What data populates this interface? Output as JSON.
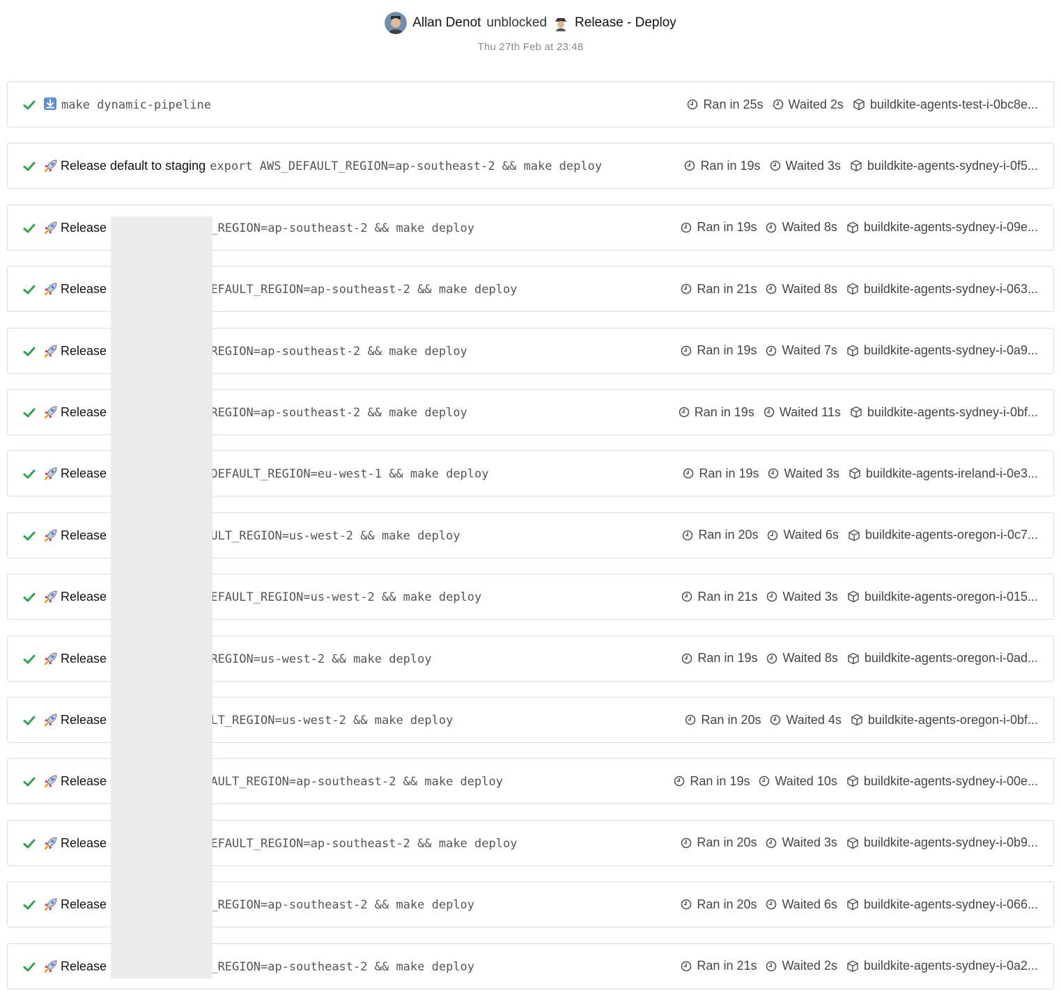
{
  "header": {
    "actor": "Allan Denot",
    "verb": "unblocked",
    "pipeline": "Release - Deploy",
    "timestamp": "Thu 27th Feb at 23:48"
  },
  "colors": {
    "success": "#2ea44f",
    "border": "#dcdcdc",
    "muted": "#8a8a8a",
    "redaction": "#ececec"
  },
  "jobs": [
    {
      "icon": "download-emoji",
      "label": "",
      "command": "make dynamic-pipeline",
      "ran": "Ran in 25s",
      "waited": "Waited 2s",
      "agent": "buildkite-agents-test-i-0bc8e..."
    },
    {
      "icon": "rocket-emoji",
      "label": "Release default to staging",
      "command": "export AWS_DEFAULT_REGION=ap-southeast-2 && make deploy",
      "ran": "Ran in 19s",
      "waited": "Waited 3s",
      "agent": "buildkite-agents-sydney-i-0f5..."
    },
    {
      "icon": "rocket-emoji",
      "label": "Release",
      "command": "rt AWS_DEFAULT_REGION=ap-southeast-2 && make deploy",
      "ran": "Ran in 19s",
      "waited": "Waited 8s",
      "agent": "buildkite-agents-sydney-i-09e..."
    },
    {
      "icon": "rocket-emoji",
      "label": "Release",
      "command": "d export AWS_DEFAULT_REGION=ap-southeast-2 && make deploy",
      "ran": "Ran in 21s",
      "waited": "Waited 8s",
      "agent": "buildkite-agents-sydney-i-063..."
    },
    {
      "icon": "rocket-emoji",
      "label": "Release",
      "command": "t AWS_DEFAULT_REGION=ap-southeast-2 && make deploy",
      "ran": "Ran in 19s",
      "waited": "Waited 7s",
      "agent": "buildkite-agents-sydney-i-0a9..."
    },
    {
      "icon": "rocket-emoji",
      "label": "Release",
      "command": "t AWS_DEFAULT_REGION=ap-southeast-2 && make deploy",
      "ran": "Ran in 19s",
      "waited": "Waited 11s",
      "agent": "buildkite-agents-sydney-i-0bf..."
    },
    {
      "icon": "rocket-emoji",
      "label": "Release",
      "command": "ox export AWS_DEFAULT_REGION=eu-west-1 && make deploy",
      "ran": "Ran in 19s",
      "waited": "Waited 3s",
      "agent": "buildkite-agents-ireland-i-0e3..."
    },
    {
      "icon": "rocket-emoji",
      "label": "Release",
      "command": "xport AWS_DEFAULT_REGION=us-west-2 && make deploy",
      "ran": "Ran in 20s",
      "waited": "Waited 6s",
      "agent": "buildkite-agents-oregon-i-0c7..."
    },
    {
      "icon": "rocket-emoji",
      "label": "Release",
      "command": "l export AWS_DEFAULT_REGION=us-west-2 && make deploy",
      "ran": "Ran in 21s",
      "waited": "Waited 3s",
      "agent": "buildkite-agents-oregon-i-015..."
    },
    {
      "icon": "rocket-emoji",
      "label": "Release",
      "command": "t AWS_DEFAULT_REGION=us-west-2 && make deploy",
      "ran": "Ran in 19s",
      "waited": "Waited 8s",
      "agent": "buildkite-agents-oregon-i-0ad..."
    },
    {
      "icon": "rocket-emoji",
      "label": "Release",
      "command": "port AWS_DEFAULT_REGION=us-west-2 && make deploy",
      "ran": "Ran in 20s",
      "waited": "Waited 4s",
      "agent": "buildkite-agents-oregon-i-0bf..."
    },
    {
      "icon": "rocket-emoji",
      "label": "Release",
      "command": "export AWS_DEFAULT_REGION=ap-southeast-2 && make deploy",
      "ran": "Ran in 19s",
      "waited": "Waited 10s",
      "agent": "buildkite-agents-sydney-i-00e..."
    },
    {
      "icon": "rocket-emoji",
      "label": "Release",
      "command": "d export AWS_DEFAULT_REGION=ap-southeast-2 && make deploy",
      "ran": "Ran in 20s",
      "waited": "Waited 3s",
      "agent": "buildkite-agents-sydney-i-0b9..."
    },
    {
      "icon": "rocket-emoji",
      "label": "Release",
      "command": "rt AWS_DEFAULT_REGION=ap-southeast-2 && make deploy",
      "ran": "Ran in 20s",
      "waited": "Waited 6s",
      "agent": "buildkite-agents-sydney-i-066..."
    },
    {
      "icon": "rocket-emoji",
      "label": "Release",
      "command": "rt AWS_DEFAULT_REGION=ap-southeast-2 && make deploy",
      "ran": "Ran in 21s",
      "waited": "Waited 2s",
      "agent": "buildkite-agents-sydney-i-0a2..."
    }
  ]
}
